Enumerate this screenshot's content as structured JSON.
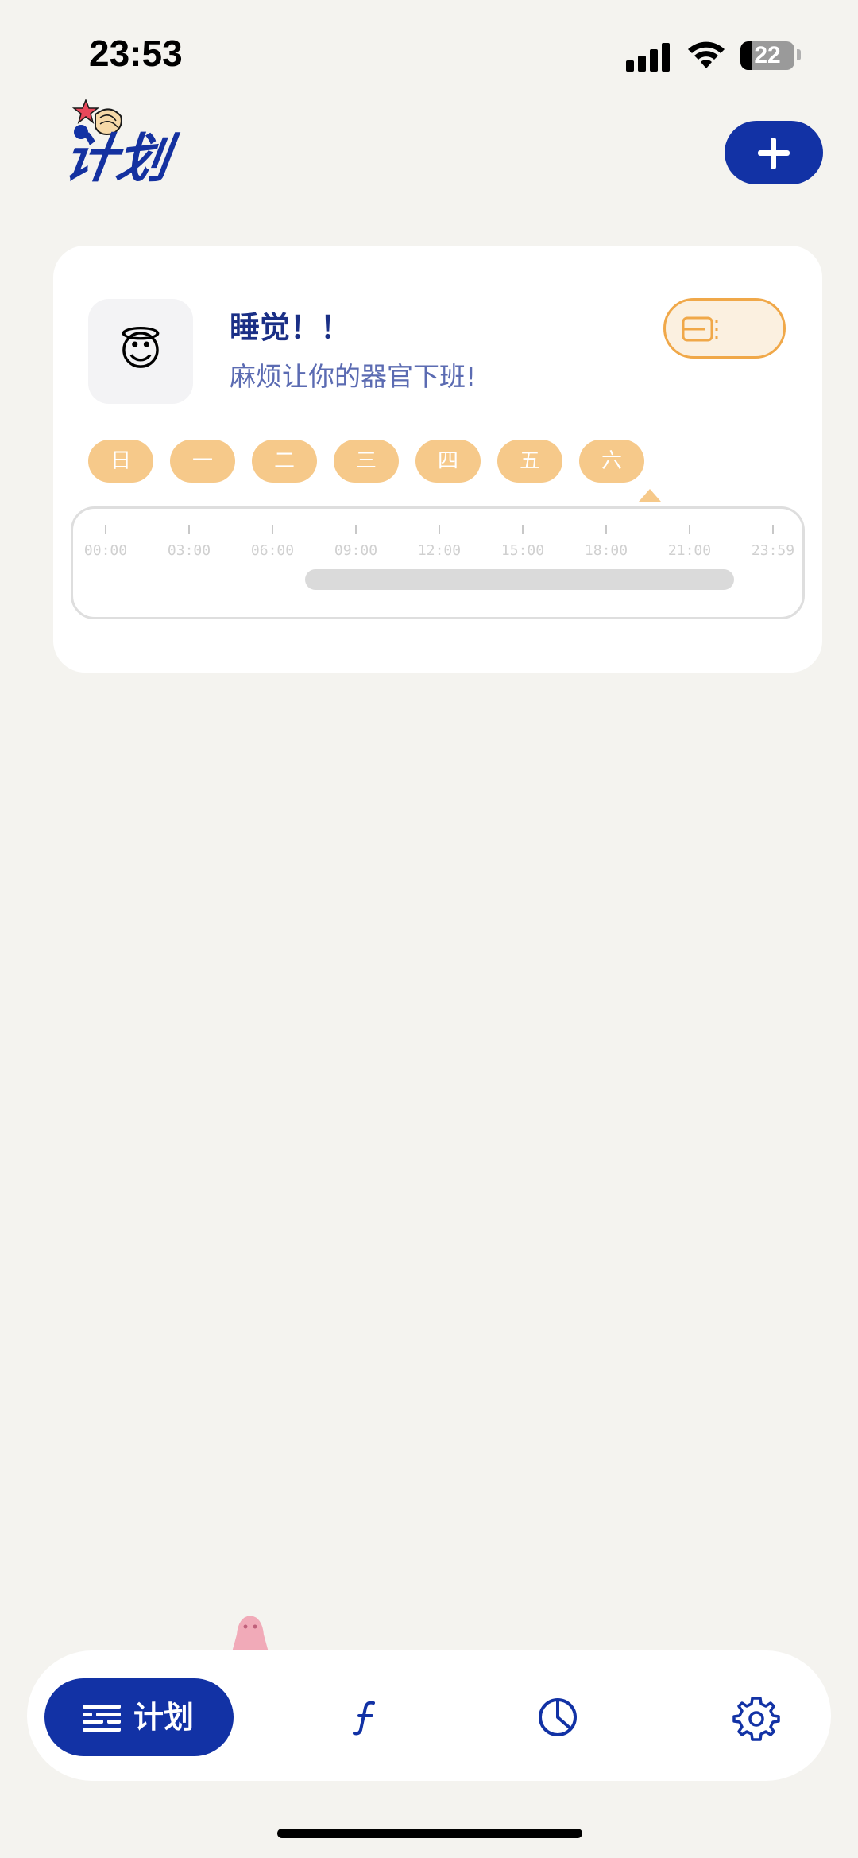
{
  "status_bar": {
    "time": "23:53",
    "battery": "22"
  },
  "header": {
    "title": "计划",
    "add_icon": "plus-icon"
  },
  "plan": {
    "emoji": "😇",
    "title": "睡觉！！",
    "subtitle": "麻烦让你的器官下班!",
    "days": [
      "日",
      "一",
      "二",
      "三",
      "四",
      "五",
      "六"
    ],
    "selected_day": "六",
    "timeline_labels": [
      "00:00",
      "03:00",
      "06:00",
      "09:00",
      "12:00",
      "15:00",
      "18:00",
      "21:00",
      "23:59"
    ]
  },
  "nav": {
    "active_label": "计划",
    "items": [
      "plan-list-icon",
      "function-icon",
      "pie-chart-icon",
      "gear-icon"
    ]
  },
  "colors": {
    "primary": "#1232a5",
    "accent_orange": "#f0a849",
    "day_pill": "#f6c98a",
    "background": "#f4f3ef"
  }
}
